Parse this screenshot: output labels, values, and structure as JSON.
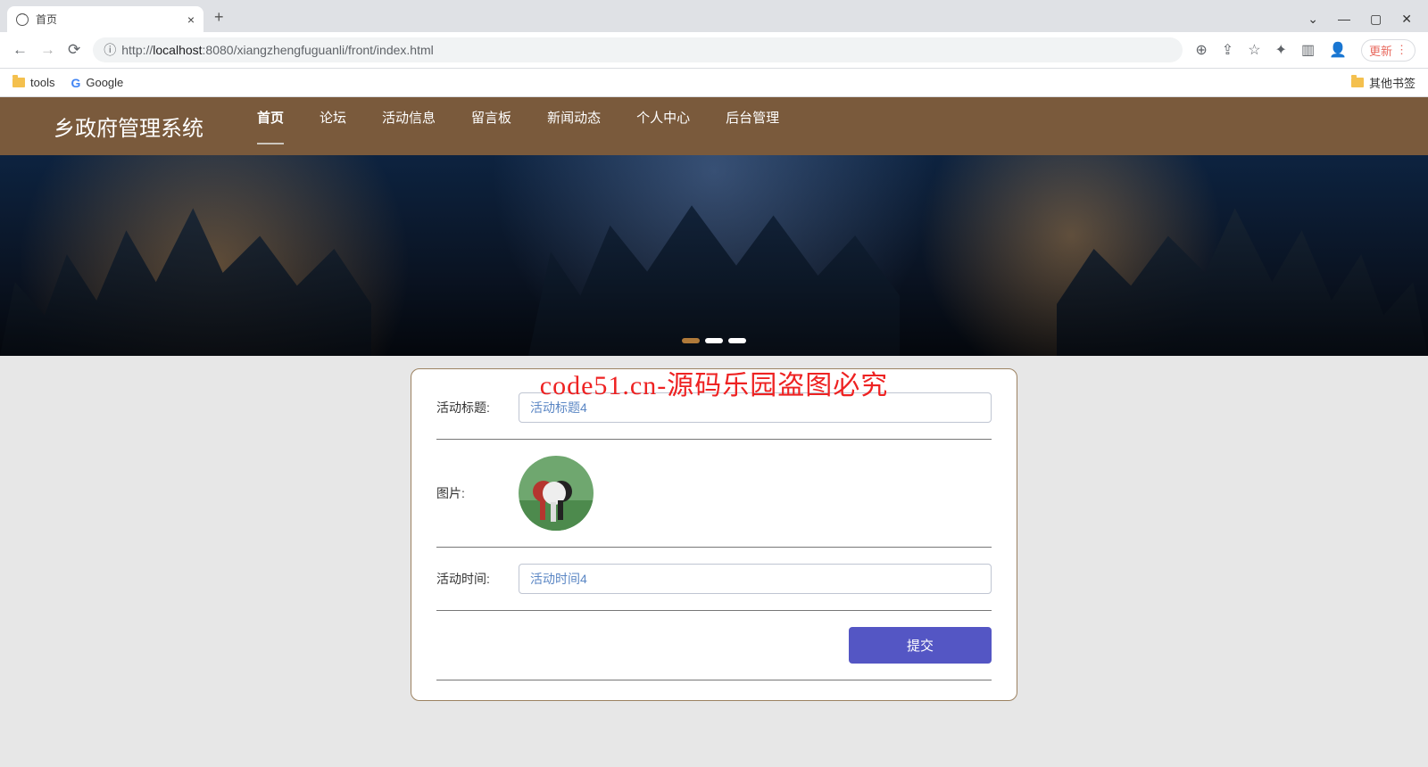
{
  "browser": {
    "tab_title": "首页",
    "new_tab": "+",
    "win": {
      "down": "⌄",
      "min": "—",
      "max": "▢",
      "close": "✕"
    },
    "nav": {
      "back": "←",
      "forward": "→",
      "reload": "⟳"
    },
    "url_icon": "ⓘ",
    "url_prefix": "http://",
    "url_host": "localhost",
    "url_rest": ":8080/xiangzhengfuguanli/front/index.html",
    "update_label": "更新",
    "bookmark_tools": "tools",
    "bookmark_google": "Google",
    "bookmark_other": "其他书签"
  },
  "header": {
    "title": "乡政府管理系统",
    "nav": [
      "首页",
      "论坛",
      "活动信息",
      "留言板",
      "新闻动态",
      "个人中心",
      "后台管理"
    ],
    "active_index": 0
  },
  "banner": {
    "dots": 3,
    "active_dot": 0
  },
  "watermark": "code51.cn-源码乐园盗图必究",
  "form": {
    "title_label": "活动标题:",
    "title_value": "活动标题4",
    "image_label": "图片:",
    "time_label": "活动时间:",
    "time_value": "活动时间4",
    "submit": "提交"
  }
}
